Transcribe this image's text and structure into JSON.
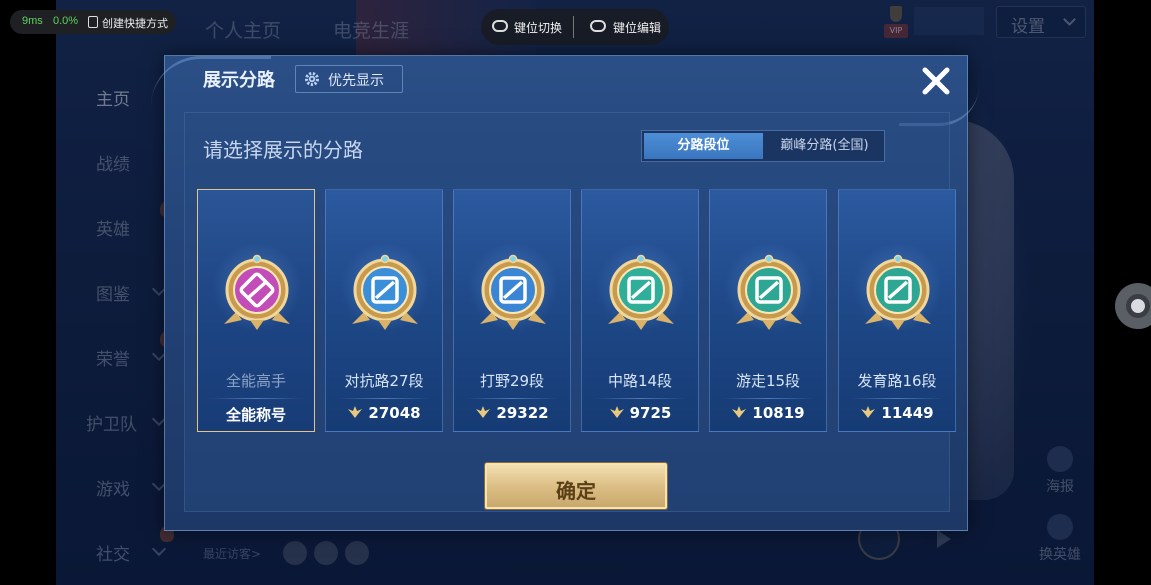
{
  "overlay": {
    "latency": "9ms",
    "cpu": "0.0%",
    "shortcut_label": "创建快捷方式"
  },
  "keybar": {
    "switch_label": "键位切换",
    "edit_label": "键位编辑"
  },
  "top_nav": {
    "tabs": [
      "个人主页",
      "电竞生涯"
    ],
    "settings_label": "设置",
    "vip_badge": "VIP"
  },
  "sidebar": {
    "items": [
      {
        "label": "主页"
      },
      {
        "label": "战绩"
      },
      {
        "label": "英雄"
      },
      {
        "label": "图鉴"
      },
      {
        "label": "荣誉"
      },
      {
        "label": "护卫队"
      },
      {
        "label": "游戏"
      },
      {
        "label": "社交"
      }
    ]
  },
  "bottom": {
    "visitors_label": "最近访客>",
    "poster_label": "海报",
    "swap_hero_label": "换英雄"
  },
  "dialog": {
    "title": "展示分路",
    "priority_label": "优先显示",
    "prompt": "请选择展示的分路",
    "segments": [
      "分路段位",
      "巅峰分路(全国)"
    ],
    "active_segment": "分路段位",
    "confirm_label": "确定",
    "cards": [
      {
        "name": "全能高手",
        "value": "全能称号",
        "kind": "title",
        "color": "#c24cb8",
        "selected": true
      },
      {
        "name": "对抗路27段",
        "value": "27048",
        "kind": "points",
        "color": "#3a8fd8",
        "selected": false
      },
      {
        "name": "打野29段",
        "value": "29322",
        "kind": "points",
        "color": "#3a86d4",
        "selected": false
      },
      {
        "name": "中路14段",
        "value": "9725",
        "kind": "points",
        "color": "#2fae9a",
        "selected": false
      },
      {
        "name": "游走15段",
        "value": "10819",
        "kind": "points",
        "color": "#2ea694",
        "selected": false
      },
      {
        "name": "发育路16段",
        "value": "11449",
        "kind": "points",
        "color": "#2ea694",
        "selected": false
      }
    ]
  }
}
